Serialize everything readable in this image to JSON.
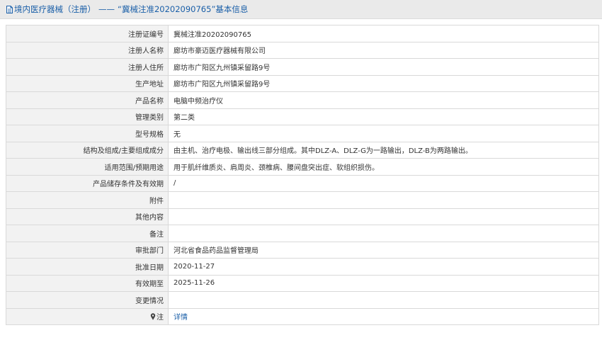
{
  "header": {
    "section": "境内医疗器械（注册）",
    "separator": "——",
    "highlight": "“冀械注准20202090765”",
    "suffix": "基本信息"
  },
  "rows": [
    {
      "label": "注册证编号",
      "value": "冀械注准20202090765"
    },
    {
      "label": "注册人名称",
      "value": "廊坊市豪迈医疗器械有限公司"
    },
    {
      "label": "注册人住所",
      "value": "廊坊市广阳区九州镇采留路9号"
    },
    {
      "label": "生产地址",
      "value": "廊坊市广阳区九州镇采留路9号"
    },
    {
      "label": "产品名称",
      "value": "电脑中频治疗仪"
    },
    {
      "label": "管理类别",
      "value": "第二类"
    },
    {
      "label": "型号规格",
      "value": "无"
    },
    {
      "label": "结构及组成/主要组成成分",
      "value": "由主机、治疗电极、输出线三部分组成。其中DLZ-A、DLZ-G为一路输出，DLZ-B为两路输出。"
    },
    {
      "label": "适用范围/预期用途",
      "value": "用于肌纤维质炎、肩周炎、颈椎病、腰间盘突出症、软组织损伤。"
    },
    {
      "label": "产品储存条件及有效期",
      "value": "/"
    },
    {
      "label": "附件",
      "value": ""
    },
    {
      "label": "其他内容",
      "value": ""
    },
    {
      "label": "备注",
      "value": ""
    },
    {
      "label": "审批部门",
      "value": "河北省食品药品监督管理局"
    },
    {
      "label": "批准日期",
      "value": "2020-11-27"
    },
    {
      "label": "有效期至",
      "value": "2025-11-26"
    },
    {
      "label": "变更情况",
      "value": ""
    }
  ],
  "note_row": {
    "icon": "pin-icon",
    "label": "注",
    "link": "详情"
  },
  "colors": {
    "accent": "#1a5fa8",
    "label_bg": "#f2f2f2",
    "border": "#d9d9d9",
    "header_bg": "#eaeaea"
  }
}
